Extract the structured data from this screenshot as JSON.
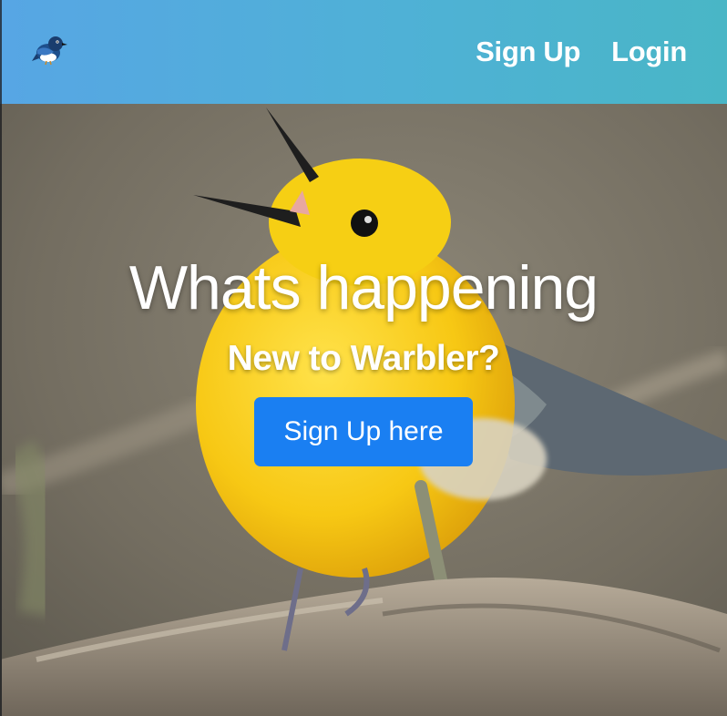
{
  "navbar": {
    "logo_icon": "warbler-bird-icon",
    "links": [
      {
        "label": "Sign Up"
      },
      {
        "label": "Login"
      }
    ]
  },
  "hero": {
    "title": "Whats happening",
    "subtitle": "New to Warbler?",
    "cta_label": "Sign Up here",
    "background_image": "yellow-warbler-bird-on-branch"
  },
  "colors": {
    "navbar_gradient_start": "#57a6e4",
    "navbar_gradient_end": "#49b6c6",
    "cta_background": "#1a7ff2",
    "text": "#ffffff"
  }
}
